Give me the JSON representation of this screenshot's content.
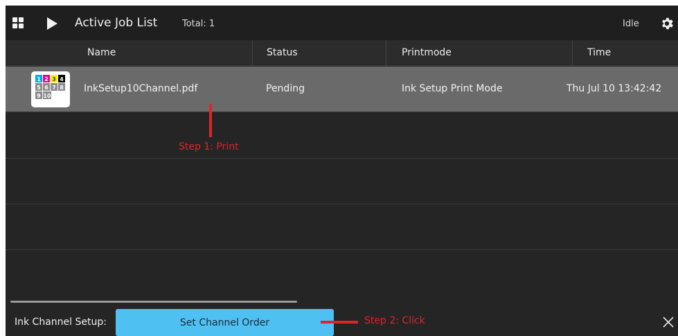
{
  "header": {
    "title": "Active Job List",
    "total": "Total: 1",
    "state": "Idle"
  },
  "table": {
    "columns": [
      "Name",
      "Status",
      "Printmode",
      "Time"
    ],
    "rows": [
      {
        "name": "InkSetup10Channel.pdf",
        "status": "Pending",
        "printmode": "Ink Setup Print Mode",
        "time": "Thu Jul 10 13:42:42",
        "thumbnail_numbers": [
          "1",
          "2",
          "3",
          "4",
          "5",
          "6",
          "7",
          "8",
          "9",
          "10"
        ]
      }
    ]
  },
  "annotations": {
    "step1": "Step 1: Print",
    "step2": "Step 2: Click"
  },
  "footer": {
    "label": "Ink Channel Setup:",
    "button_label": "Set Channel Order"
  },
  "colors": {
    "accent": "#4fc0f2",
    "annotation": "#e0242a",
    "selected_row": "#6a6a6a",
    "cyan": "#00aeef",
    "magenta": "#ec008c",
    "yellow": "#fff200",
    "black": "#000000",
    "gray": "#8a8a8a"
  },
  "icons": [
    "grid-icon",
    "play-icon",
    "gear-icon",
    "close-icon"
  ]
}
